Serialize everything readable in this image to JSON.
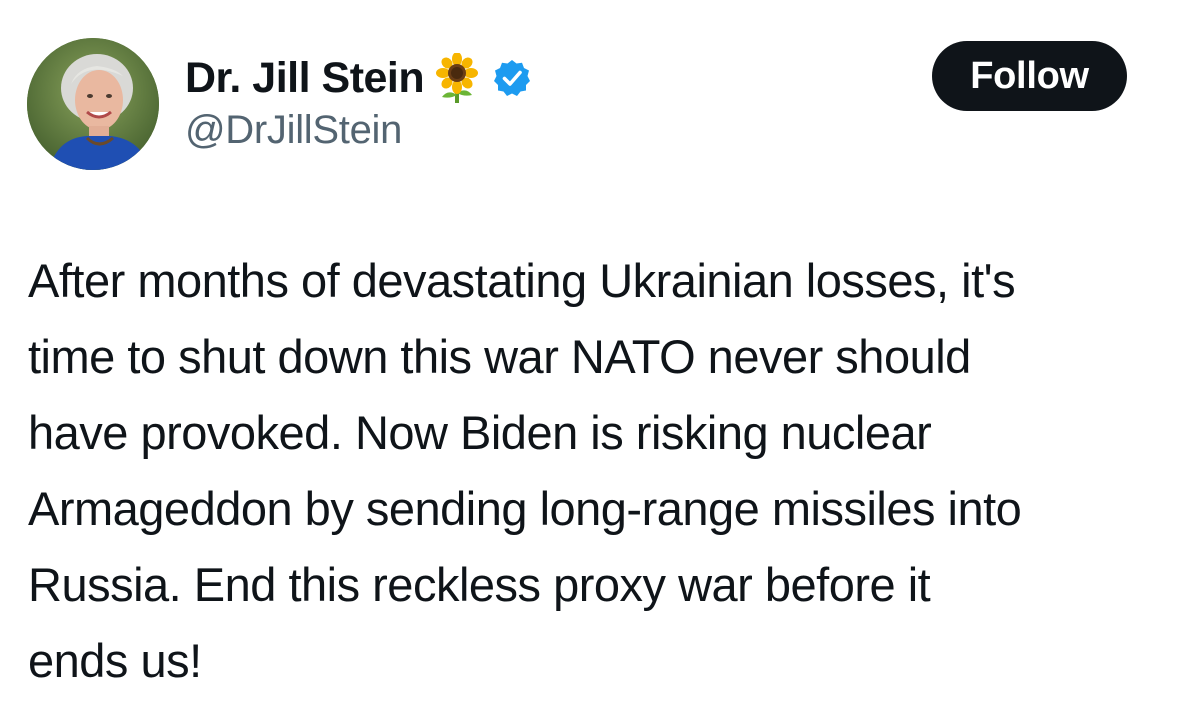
{
  "author": {
    "display_name": "Dr. Jill Stein",
    "handle": "@DrJillStein",
    "name_emoji": "sunflower-icon",
    "verified_icon": "verified-badge-icon",
    "avatar_icon": "avatar"
  },
  "actions": {
    "follow_label": "Follow"
  },
  "tweet": {
    "lines": [
      "After months of devastating Ukrainian losses, it's",
      "time to shut down this war NATO never should",
      "have provoked. Now Biden is risking nuclear",
      "Armageddon by sending long-range missiles into",
      "Russia. End this reckless proxy war before it",
      "ends us!"
    ]
  },
  "colors": {
    "text_primary": "#0f1419",
    "text_secondary": "#536471",
    "verified_blue": "#1d9bf0",
    "button_bg": "#0f1419",
    "button_text": "#ffffff"
  }
}
